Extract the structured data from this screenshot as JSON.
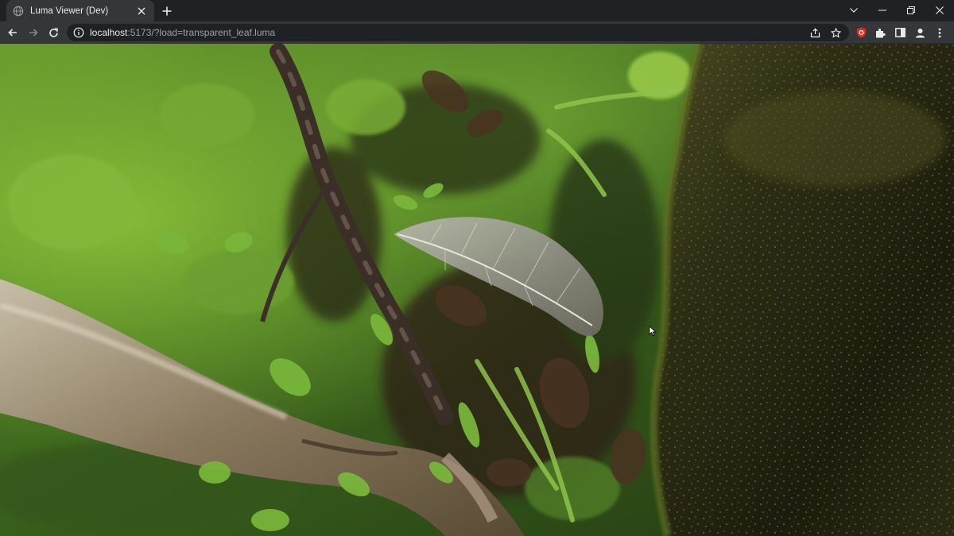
{
  "browser": {
    "tab": {
      "title": "Luma Viewer (Dev)",
      "favicon": "globe-icon"
    },
    "address": {
      "host": "localhost",
      "rest": ":5173/?load=transparent_leaf.luma"
    }
  },
  "icons": {
    "back": "arrow-left-icon",
    "forward": "arrow-right-icon",
    "reload": "reload-icon",
    "share": "share-icon",
    "bookmark": "star-icon",
    "extension_shield": "shield-extension-icon",
    "extensions": "puzzle-icon",
    "side_panel": "side-panel-icon",
    "profile": "profile-icon",
    "menu": "kebab-menu-icon"
  },
  "colors": {
    "tabstrip_bg": "#202124",
    "toolbar_bg": "#35363a",
    "omnibox_bg": "#202124",
    "text": "#e8eaed",
    "muted_text": "#9aa0a6",
    "extension_red": "#d93025"
  }
}
